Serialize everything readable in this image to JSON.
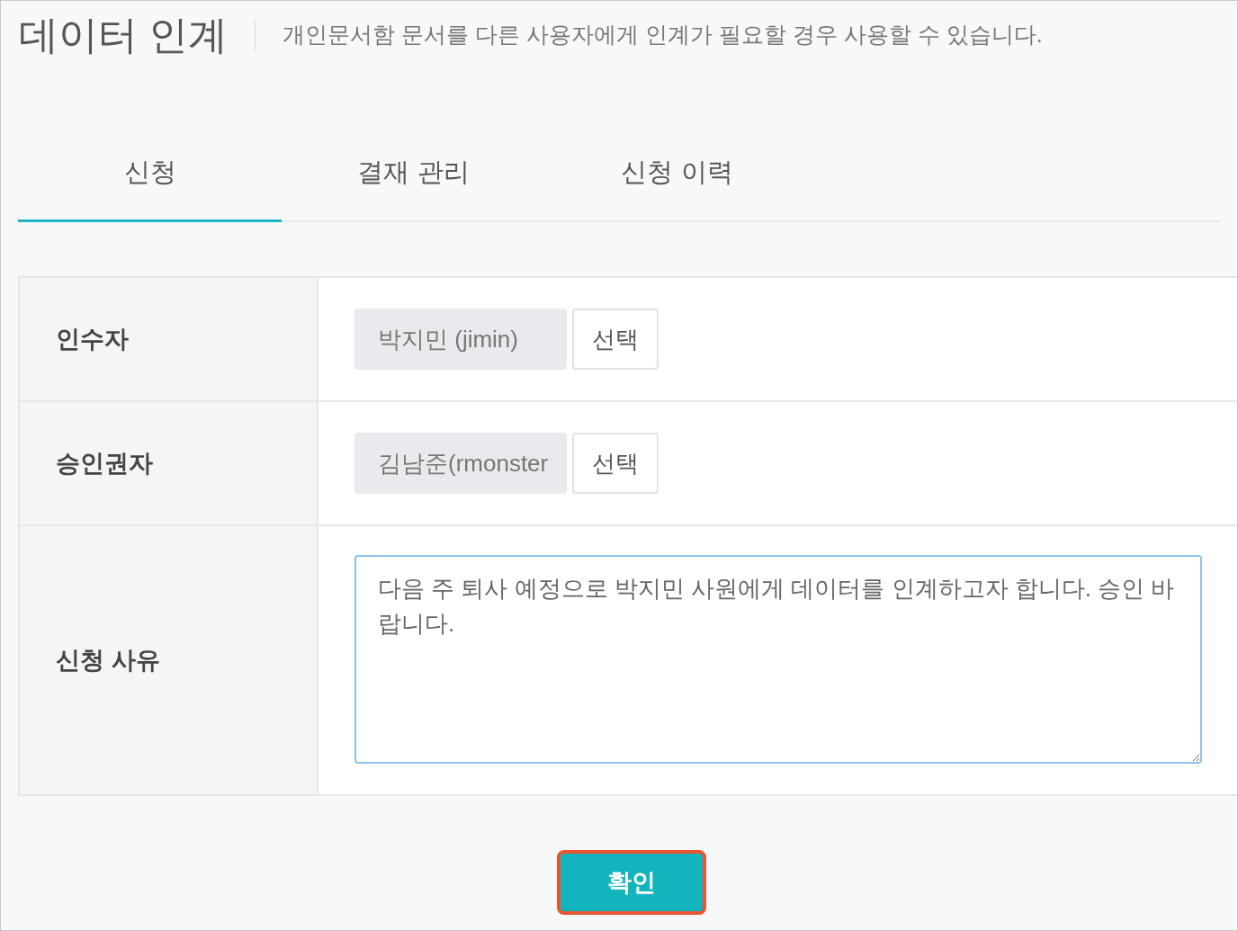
{
  "header": {
    "title": "데이터 인계",
    "description": "개인문서함 문서를 다른 사용자에게 인계가 필요할 경우 사용할 수 있습니다."
  },
  "tabs": [
    {
      "label": "신청",
      "selected": true
    },
    {
      "label": "결재 관리",
      "selected": false
    },
    {
      "label": "신청 이력",
      "selected": false
    }
  ],
  "form": {
    "rows": [
      {
        "kind": "picker",
        "label": "인수자",
        "value": "박지민 (jimin)",
        "button": "선택"
      },
      {
        "kind": "picker",
        "label": "승인권자",
        "value": "김남준(rmonster",
        "button": "선택"
      },
      {
        "kind": "textarea",
        "label": "신청 사유",
        "value": "다음 주 퇴사 예정으로 박지민 사원에게 데이터를 인계하고자 합니다. 승인 바랍니다."
      }
    ]
  },
  "confirm_button": {
    "label": "확인",
    "highlighted": true
  }
}
